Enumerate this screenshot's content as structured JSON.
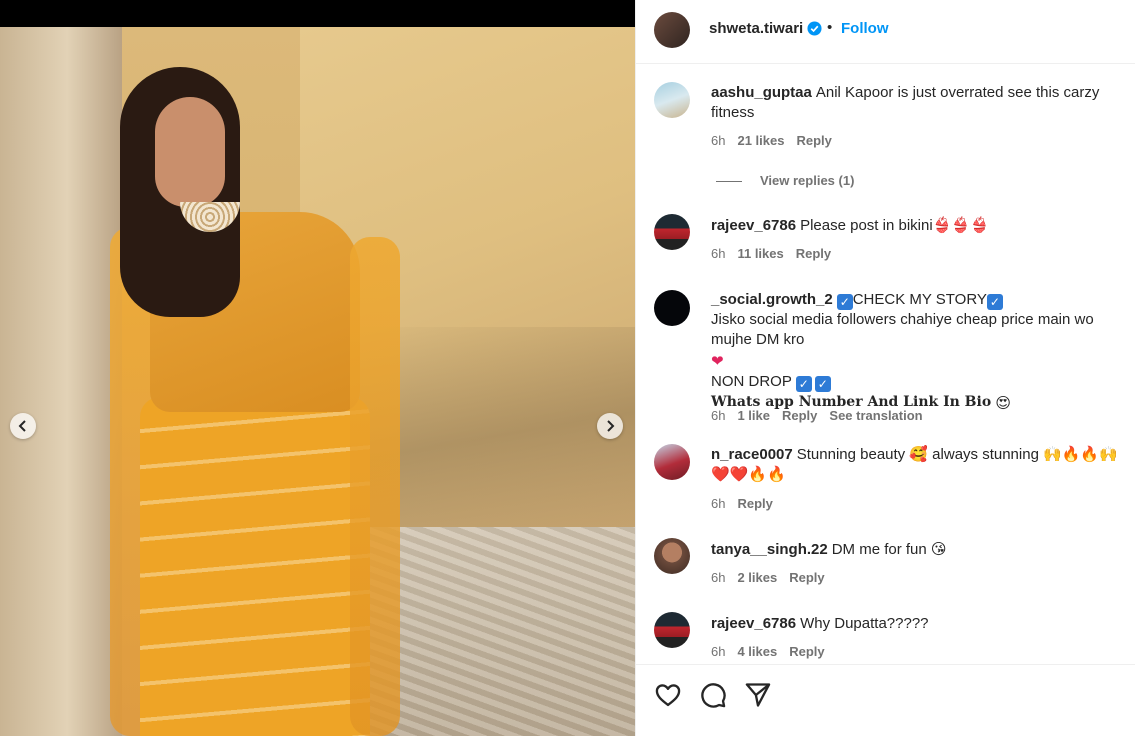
{
  "post": {
    "username": "shweta.tiwari",
    "verified": true,
    "separator": "•",
    "follow_label": "Follow"
  },
  "comments": [
    {
      "user": "aashu_guptaa",
      "text": "Anil Kapoor is just overrated see this carzy fitness",
      "time": "6h",
      "likes": "21 likes",
      "reply": "Reply",
      "view_replies": "View replies (1)",
      "avatar": "beach-photo"
    },
    {
      "user": "rajeev_6786",
      "text": "Please post in bikini👙👙👙",
      "time": "6h",
      "likes": "11 likes",
      "reply": "Reply",
      "avatar": "red-car"
    },
    {
      "user": "_social.growth_2",
      "line1": "CHECK MY STORY",
      "line2": "Jisko social media followers chahiye cheap price main wo mujhe DM kro",
      "line3": "NON DROP",
      "line4": "Whats app Number And Link In Bio",
      "time": "6h",
      "likes": "1 like",
      "reply": "Reply",
      "see_translation": "See translation",
      "avatar": "social-logo"
    },
    {
      "user": "n_race0007",
      "text": "Stunning beauty 🥰 always stunning 🙌🔥🔥🙌",
      "text2": "❤️❤️🔥🔥",
      "time": "6h",
      "reply": "Reply",
      "avatar": "car-portrait"
    },
    {
      "user": "tanya__singh.22",
      "text": "DM me for fun 😘",
      "time": "6h",
      "likes": "2 likes",
      "reply": "Reply",
      "avatar": "woman-portrait"
    },
    {
      "user": "rajeev_6786",
      "text": "Why Dupatta?????",
      "time": "6h",
      "likes": "4 likes",
      "reply": "Reply",
      "avatar": "red-car"
    }
  ],
  "icons": {
    "like": "heart-icon",
    "comment": "comment-bubble-icon",
    "share": "paper-plane-icon",
    "verified": "verified-badge-icon",
    "prev": "chevron-left-icon",
    "next": "chevron-right-icon"
  },
  "colors": {
    "link_blue": "#0095f6",
    "verified_blue": "#0095f6",
    "meta_gray": "#737373",
    "text": "#262626"
  }
}
